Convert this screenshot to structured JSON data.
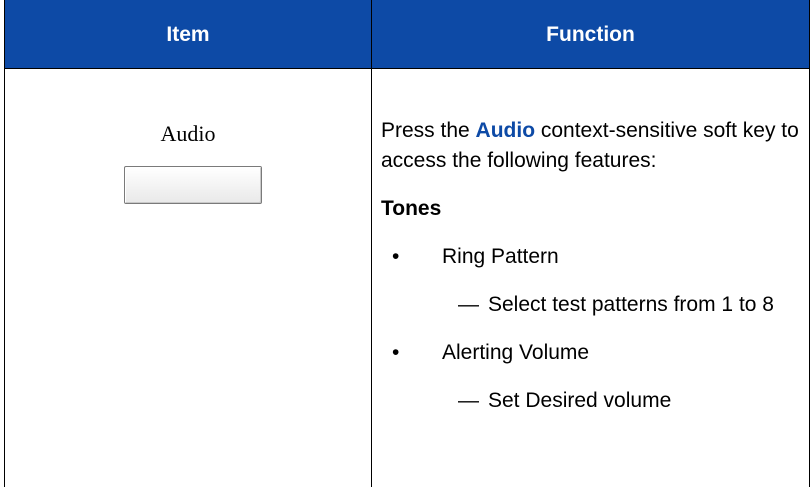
{
  "header": {
    "item": "Item",
    "function": "Function"
  },
  "item": {
    "label": "Audio"
  },
  "function": {
    "intro_pre": "Press the ",
    "intro_keyword": "Audio",
    "intro_post": " context-sensitive soft key to access the following features:",
    "section_title": "Tones",
    "bullets": [
      {
        "marker": "•",
        "text": "Ring Pattern",
        "sub": {
          "marker": "—",
          "text": "Select test patterns from 1 to 8"
        }
      },
      {
        "marker": "•",
        "text": "Alerting Volume",
        "sub": {
          "marker": "—",
          "text": "Set Desired volume"
        }
      }
    ]
  },
  "colors": {
    "header_bg": "#0d4aa6",
    "keyword": "#0d4aa6"
  }
}
